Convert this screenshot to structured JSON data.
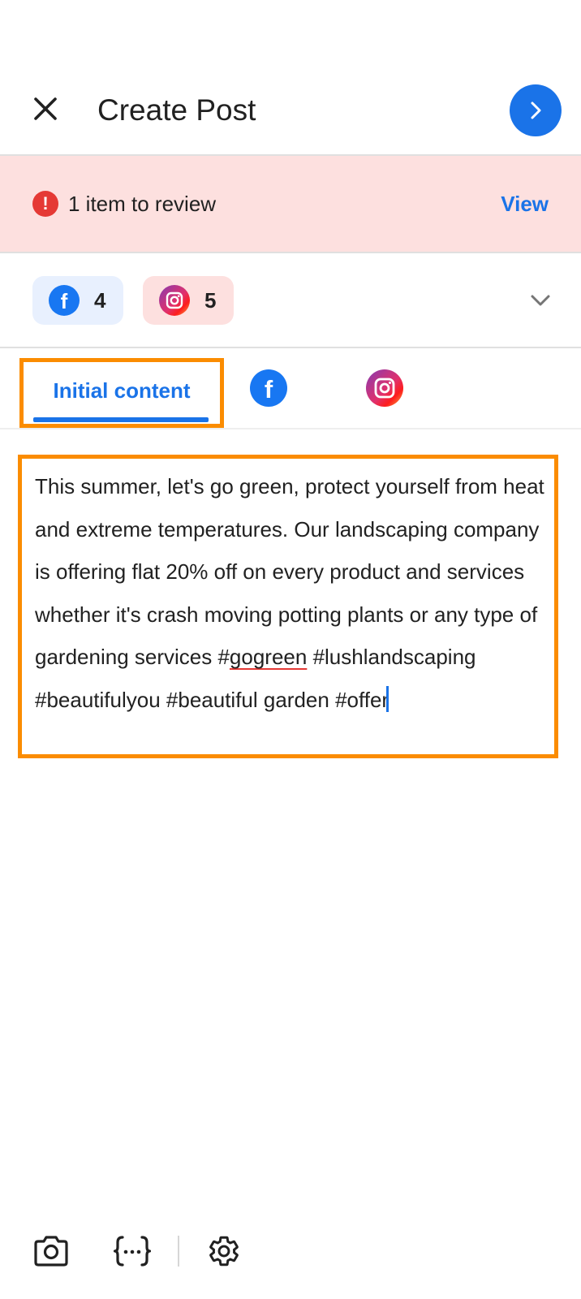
{
  "header": {
    "title": "Create Post",
    "close_icon": "close-icon",
    "next_icon": "chevron-right-icon"
  },
  "review": {
    "alert_icon": "!",
    "text": "1 item to review",
    "view_label": "View"
  },
  "channels": {
    "facebook": {
      "icon": "facebook-icon",
      "count": "4"
    },
    "instagram": {
      "icon": "instagram-icon",
      "count": "5"
    },
    "expand_icon": "chevron-down-icon"
  },
  "tabs": {
    "initial_label": "Initial content",
    "facebook_icon": "facebook-icon",
    "instagram_icon": "instagram-icon"
  },
  "post": {
    "text_before": "This summer, let's go green, protect yourself from heat and extreme temperatures. Our landscaping company is offering flat 20% off on every product and services whether it's crash moving potting plants or any type of gardening services #",
    "misspelled": "gogreen",
    "text_after": " #lushlandscaping #beautifulyou #beautiful garden #offer"
  },
  "toolbar": {
    "camera_icon": "camera-icon",
    "variables_icon": "variables-icon",
    "settings_icon": "gear-icon"
  },
  "colors": {
    "accent": "#1a73e8",
    "banner_bg": "#fde0df",
    "alert": "#e53935",
    "highlight_border": "#fb8c00",
    "facebook": "#1877f2"
  }
}
